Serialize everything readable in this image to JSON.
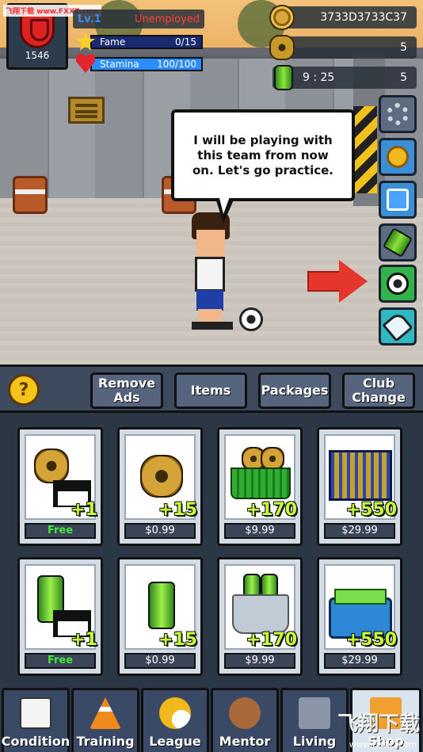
{
  "watermark_top": "飞翔下载 www.FXXZ.com",
  "player": {
    "team_number": "1546",
    "level": "Lv.1",
    "job_status": "Unemployed",
    "fame_label": "Fame",
    "fame_value": "0/15",
    "fame_fraction": 0.0,
    "stamina_label": "Stamina",
    "stamina_value": "100/100",
    "stamina_fraction": 1.0
  },
  "currencies": {
    "coins": "3733D3733C37",
    "gems": "5",
    "energy_timer": "9 : 25",
    "energy": "5"
  },
  "speech": "I will be playing with this team from now on. Let's go practice.",
  "side_buttons": [
    {
      "name": "settings",
      "icon": "gear-icon"
    },
    {
      "name": "achievements",
      "icon": "medal-icon"
    },
    {
      "name": "ranking",
      "icon": "podium-icon"
    },
    {
      "name": "energy-drink",
      "icon": "energy-can-icon"
    },
    {
      "name": "match",
      "icon": "soccer-ball-icon"
    },
    {
      "name": "equipment",
      "icon": "boot-icon"
    }
  ],
  "shop": {
    "help_label": "?",
    "tabs": [
      {
        "label": "Remove Ads"
      },
      {
        "label": "Items"
      },
      {
        "label": "Packages"
      },
      {
        "label": "Club Change"
      }
    ],
    "products": [
      {
        "amount": "+1",
        "price": "Free",
        "art": "coin-video"
      },
      {
        "amount": "+15",
        "price": "$0.99",
        "art": "coin"
      },
      {
        "amount": "+170",
        "price": "$9.99",
        "art": "coin-basket"
      },
      {
        "amount": "+550",
        "price": "$29.99",
        "art": "coin-cage"
      },
      {
        "amount": "+1",
        "price": "Free",
        "art": "can-video"
      },
      {
        "amount": "+15",
        "price": "$0.99",
        "art": "can"
      },
      {
        "amount": "+170",
        "price": "$9.99",
        "art": "can-bucket"
      },
      {
        "amount": "+550",
        "price": "$29.99",
        "art": "can-cooler"
      }
    ]
  },
  "nav": [
    {
      "label": "Condition",
      "icon": "clipboard-icon"
    },
    {
      "label": "Training",
      "icon": "cone-icon"
    },
    {
      "label": "League",
      "icon": "trophy-icon"
    },
    {
      "label": "Mentor",
      "icon": "people-icon"
    },
    {
      "label": "Living",
      "icon": "house-icon"
    },
    {
      "label": "Shop",
      "icon": "cart-icon"
    }
  ],
  "watermark_bottom": "飞翔下载",
  "watermark_bottom_url": "www.FXXZ.com",
  "colors": {
    "panel": "#2c3746",
    "accent_green": "#c8ff3a",
    "free_green": "#45e83a",
    "job_red": "#ff4040",
    "level_blue": "#3d8cff"
  }
}
